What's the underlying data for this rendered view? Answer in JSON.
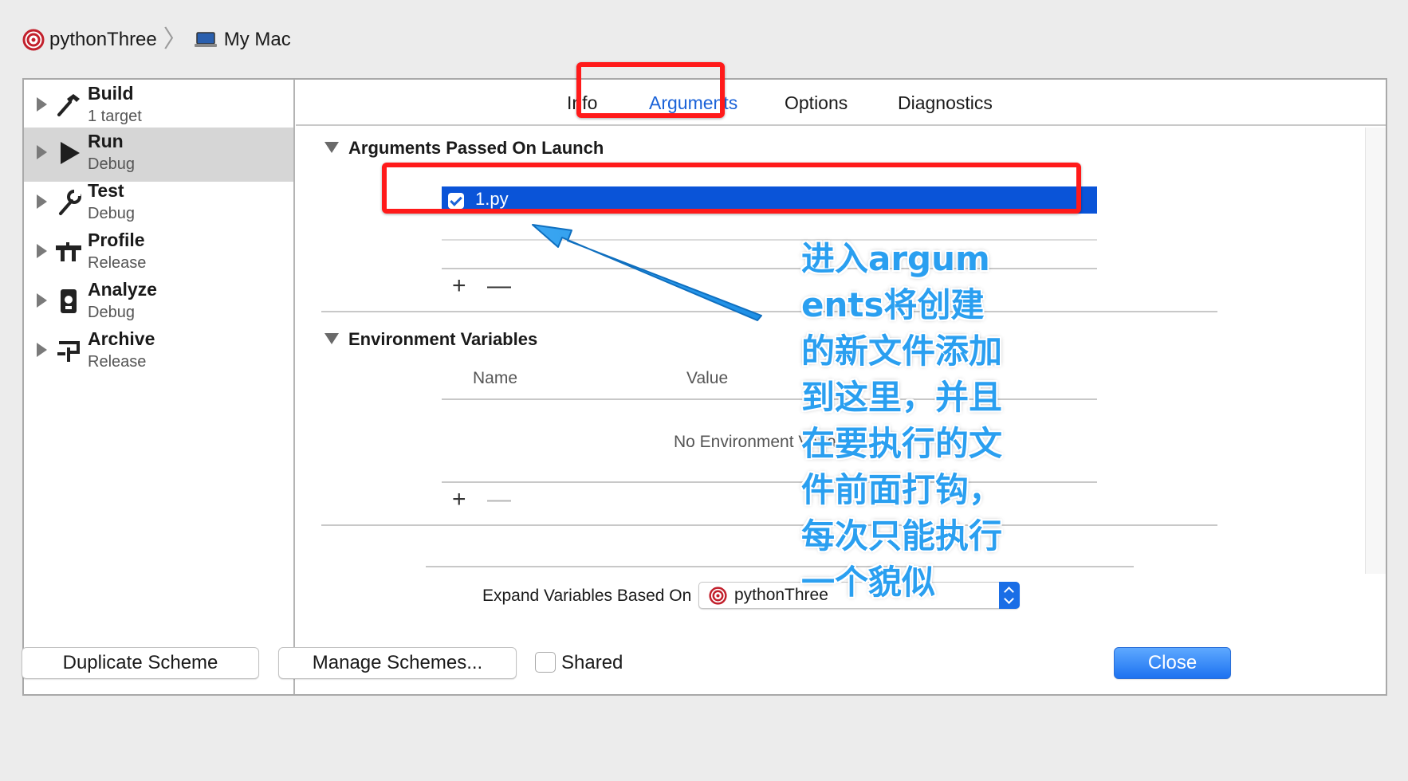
{
  "breadcrumb": {
    "target": "pythonThree",
    "destination": "My Mac"
  },
  "sidebar": {
    "items": [
      {
        "title": "Build",
        "subtitle": "1 target",
        "icon": "hammer-icon"
      },
      {
        "title": "Run",
        "subtitle": "Debug",
        "icon": "play-icon"
      },
      {
        "title": "Test",
        "subtitle": "Debug",
        "icon": "wrench-icon"
      },
      {
        "title": "Profile",
        "subtitle": "Release",
        "icon": "gauge-icon"
      },
      {
        "title": "Analyze",
        "subtitle": "Debug",
        "icon": "analyze-icon"
      },
      {
        "title": "Archive",
        "subtitle": "Release",
        "icon": "archive-icon"
      }
    ],
    "selected": "Run"
  },
  "tabs": {
    "items": [
      "Info",
      "Arguments",
      "Options",
      "Diagnostics"
    ],
    "active": "Arguments"
  },
  "arguments_section": {
    "title": "Arguments Passed On Launch",
    "rows": [
      {
        "checked": true,
        "value": "1.py"
      }
    ],
    "add_symbol": "+",
    "remove_symbol": "—"
  },
  "env_section": {
    "title": "Environment Variables",
    "columns": [
      "Name",
      "Value"
    ],
    "empty_message": "No Environment Variab",
    "add_symbol": "+",
    "remove_symbol": "—"
  },
  "expand": {
    "label": "Expand Variables Based On",
    "selected": "pythonThree"
  },
  "annotation": {
    "text": "进入arguments将创建的新文件添加到这里，并且在要执行的文件前面打钩，每次只能执行一个貌似",
    "color": "#2a9ff0"
  },
  "bottom": {
    "duplicate_label": "Duplicate Scheme",
    "manage_label": "Manage Schemes...",
    "shared_label": "Shared",
    "close_label": "Close"
  },
  "colors": {
    "accent": "#1a62d8",
    "selection": "#0a54d8",
    "highlight_box": "#ff1a1a"
  }
}
